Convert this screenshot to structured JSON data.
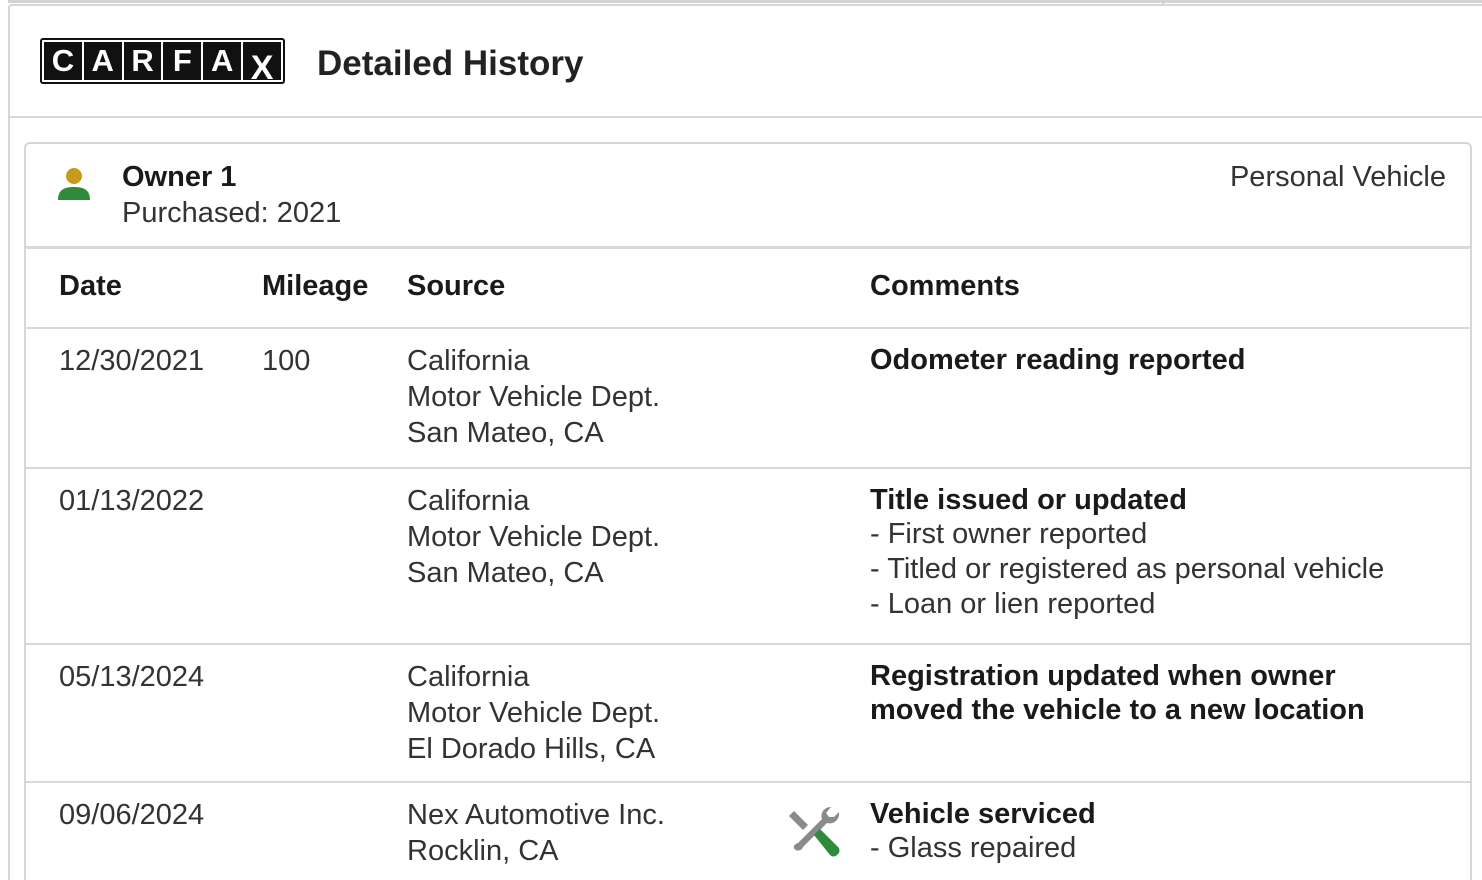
{
  "header": {
    "logo_letters": [
      "C",
      "A",
      "R",
      "F",
      "A",
      "X"
    ],
    "title": "Detailed History"
  },
  "owner": {
    "icon": "person-icon",
    "label": "Owner 1",
    "purchased": "Purchased: 2021",
    "vehicle_type": "Personal Vehicle",
    "icon_colors": {
      "head": "#c89a1c",
      "body": "#2e8b3a"
    }
  },
  "table": {
    "columns": {
      "date": "Date",
      "mileage": "Mileage",
      "source": "Source",
      "comments": "Comments"
    },
    "rows": [
      {
        "date": "12/30/2021",
        "mileage": "100",
        "source": [
          "California",
          "Motor Vehicle Dept.",
          "San Mateo, CA"
        ],
        "comment_title": "Odometer reading reported",
        "comment_items": []
      },
      {
        "date": "01/13/2022",
        "mileage": "",
        "source": [
          "California",
          "Motor Vehicle Dept.",
          "San Mateo, CA"
        ],
        "comment_title": "Title issued or updated",
        "comment_items": [
          "- First owner reported",
          "- Titled or registered as personal vehicle",
          "- Loan or lien reported"
        ]
      },
      {
        "date": "05/13/2024",
        "mileage": "",
        "source": [
          "California",
          "Motor Vehicle Dept.",
          "El Dorado Hills, CA"
        ],
        "comment_title": [
          "Registration updated when owner",
          "moved the vehicle to a new location"
        ],
        "comment_items": []
      },
      {
        "date": "09/06/2024",
        "mileage": "",
        "source": [
          "Nex Automotive Inc.",
          "Rocklin, CA"
        ],
        "icon": "wrench-screwdriver-icon",
        "comment_title": "Vehicle serviced",
        "comment_items": [
          "- Glass repaired"
        ]
      }
    ]
  },
  "colors": {
    "border": "#d9d9d9",
    "service_icon_green": "#2e8b3a",
    "service_icon_gray": "#8a8a8a"
  }
}
